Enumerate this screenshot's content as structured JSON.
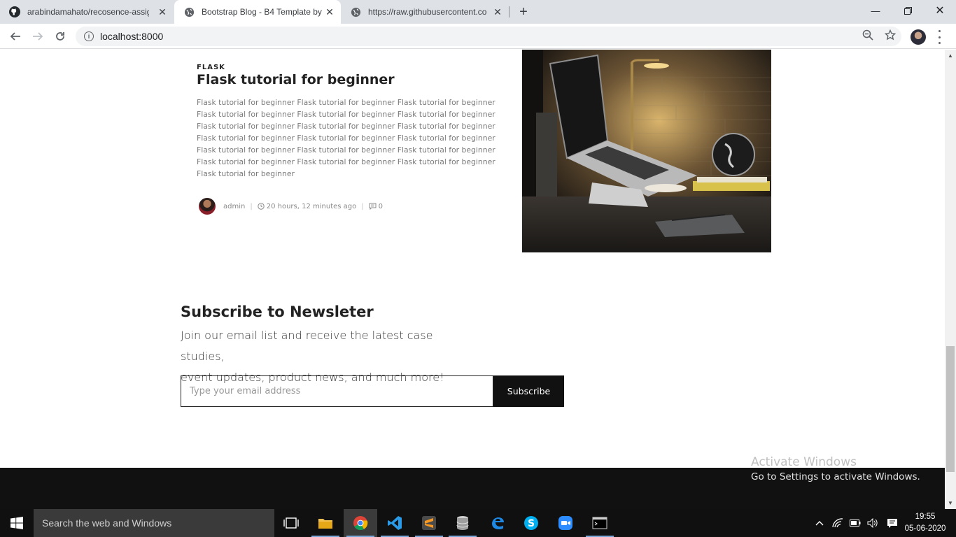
{
  "browser": {
    "tabs": [
      {
        "title": "arabindamahato/recosence-assig",
        "icon": "github-icon"
      },
      {
        "title": "Bootstrap Blog - B4 Template by",
        "icon": "globe-icon",
        "active": true
      },
      {
        "title": "https://raw.githubusercontent.co",
        "icon": "globe-icon"
      }
    ],
    "url": "localhost:8000"
  },
  "post": {
    "category": "FLASK",
    "title": "Flask tutorial for beginner",
    "body": "Flask tutorial for beginner Flask tutorial for beginner Flask tutorial for beginner Flask tutorial for beginner Flask tutorial for beginner Flask tutorial for beginner Flask tutorial for beginner Flask tutorial for beginner Flask tutorial for beginner Flask tutorial for beginner Flask tutorial for beginner Flask tutorial for beginner Flask tutorial for beginner Flask tutorial for beginner Flask tutorial for beginner Flask tutorial for beginner Flask tutorial for beginner Flask tutorial for beginner Flask tutorial for beginner",
    "author": "admin",
    "time": "20 hours, 12 minutes ago",
    "comments": "0"
  },
  "newsletter": {
    "title": "Subscribe to Newsleter",
    "desc_line1": "Join our email list and receive the latest case studies,",
    "desc_line2": "event updates, product news, and much more!",
    "placeholder": "Type your email address",
    "button": "Subscribe"
  },
  "watermark": {
    "line1": "Activate Windows",
    "line2": "Go to Settings to activate Windows."
  },
  "taskbar": {
    "search_placeholder": "Search the web and Windows",
    "time": "19:55",
    "date": "05-06-2020"
  }
}
